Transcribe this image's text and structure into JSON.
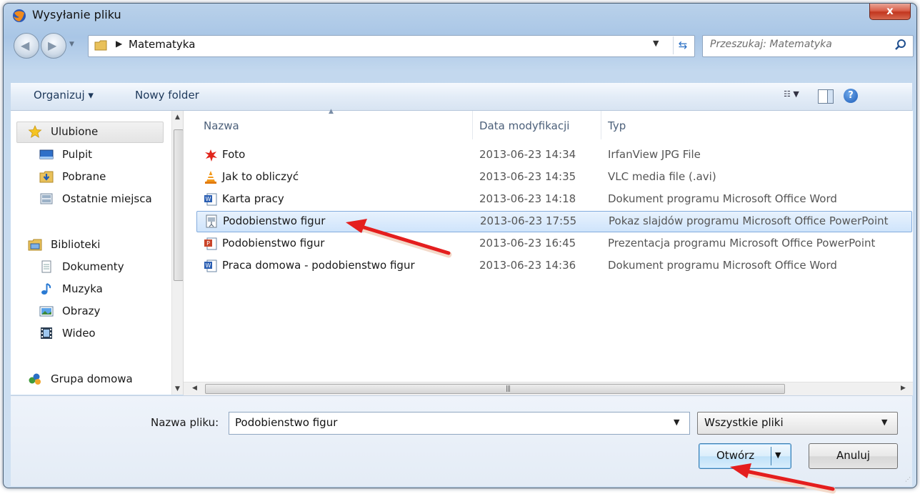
{
  "window": {
    "title": "Wysyłanie pliku",
    "close_label": "x"
  },
  "address": {
    "path_segment": "Matematyka",
    "search_placeholder": "Przeszukaj: Matematyka"
  },
  "toolbar": {
    "organize_label": "Organizuj ▾",
    "new_folder_label": "Nowy folder"
  },
  "navigation": {
    "favorites": {
      "label": "Ulubione",
      "items": [
        "Pulpit",
        "Pobrane",
        "Ostatnie miejsca"
      ]
    },
    "libraries": {
      "label": "Biblioteki",
      "items": [
        "Dokumenty",
        "Muzyka",
        "Obrazy",
        "Wideo"
      ]
    },
    "homegroup": {
      "label": "Grupa domowa"
    }
  },
  "file_list": {
    "columns": [
      "Nazwa",
      "Data modyfikacji",
      "Typ"
    ],
    "rows": [
      {
        "name": "Foto",
        "date": "2013-06-23 14:34",
        "type": "IrfanView JPG File",
        "icon": "irfanview-jpg-icon"
      },
      {
        "name": "Jak to obliczyć",
        "date": "2013-06-23 14:35",
        "type": "VLC media file (.avi)",
        "icon": "vlc-icon"
      },
      {
        "name": "Karta pracy",
        "date": "2013-06-23 14:18",
        "type": "Dokument programu Microsoft Office Word",
        "icon": "word-doc-icon"
      },
      {
        "name": "Podobienstwo figur",
        "date": "2013-06-23 17:55",
        "type": "Pokaz slajdów programu Microsoft Office PowerPoint",
        "icon": "powerpoint-show-icon",
        "selected": true
      },
      {
        "name": "Podobienstwo figur",
        "date": "2013-06-23 16:45",
        "type": "Prezentacja programu Microsoft Office PowerPoint",
        "icon": "powerpoint-presentation-icon"
      },
      {
        "name": "Praca domowa - podobienstwo figur",
        "date": "2013-06-23 14:36",
        "type": "Dokument programu Microsoft Office Word",
        "icon": "word-doc-icon"
      }
    ]
  },
  "footer": {
    "filename_label": "Nazwa pliku:",
    "filename_value": "Podobienstwo figur",
    "filetype_value": "Wszystkie pliki",
    "open_label": "Otwórz",
    "cancel_label": "Anuluj"
  },
  "colors": {
    "accent": "#2a6fc4",
    "selection": "#cfe4fb",
    "annotation_arrow": "#e41e1e",
    "close_button": "#c2361f"
  }
}
